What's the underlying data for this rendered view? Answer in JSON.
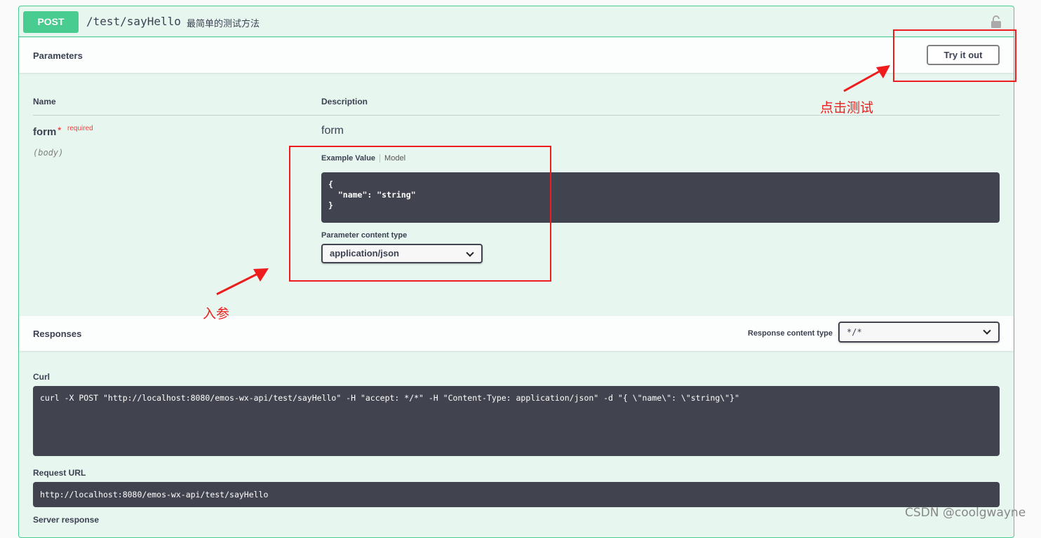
{
  "operation": {
    "method": "POST",
    "path": "/test/sayHello",
    "summary": "最简单的测试方法",
    "lock_icon": "lock-icon"
  },
  "parameters": {
    "title": "Parameters",
    "try_it_out": "Try it out",
    "col_name": "Name",
    "col_description": "Description",
    "param": {
      "name": "form",
      "asterisk": "*",
      "required": "required",
      "in": "(body)",
      "description": "form"
    },
    "tabs": {
      "example_value": "Example Value",
      "model": "Model"
    },
    "example_code": "{\n  \"name\": \"string\"\n}",
    "content_type_label": "Parameter content type",
    "content_type_value": "application/json"
  },
  "responses": {
    "title": "Responses",
    "content_type_label": "Response content type",
    "content_type_value": "*/*",
    "curl_label": "Curl",
    "curl": "curl -X POST \"http://localhost:8080/emos-wx-api/test/sayHello\" -H \"accept: */*\" -H \"Content-Type: application/json\" -d \"{ \\\"name\\\": \\\"string\\\"}\"",
    "request_url_label": "Request URL",
    "request_url": "http://localhost:8080/emos-wx-api/test/sayHello",
    "server_response_label": "Server response"
  },
  "annotations": {
    "try_label": "点击测试",
    "input_label": "入参",
    "color": "#ee1c1c"
  },
  "watermark": "CSDN @coolgwayne"
}
